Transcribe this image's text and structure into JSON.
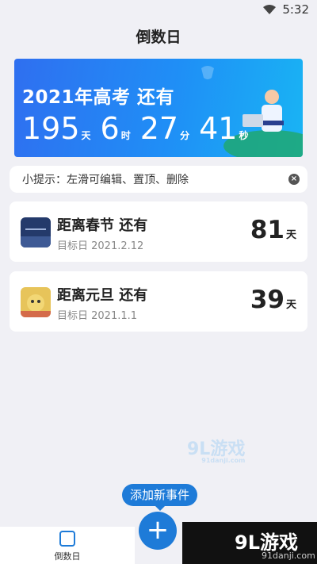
{
  "status": {
    "time": "5:32"
  },
  "header": {
    "title": "倒数日"
  },
  "banner": {
    "title": "2021年高考 还有",
    "days": "195",
    "days_unit": "天",
    "hours": "6",
    "hours_unit": "时",
    "minutes": "27",
    "minutes_unit": "分",
    "seconds": "41",
    "seconds_unit": "秒"
  },
  "tip": {
    "text": "小提示：左滑可编辑、置顶、删除"
  },
  "events": [
    {
      "name": "距离春节 还有",
      "target": "目标日 2021.2.12",
      "days": "81",
      "unit": "天"
    },
    {
      "name": "距离元旦 还有",
      "target": "目标日 2021.1.1",
      "days": "39",
      "unit": "天"
    }
  ],
  "fab": {
    "tooltip": "添加新事件",
    "icon": "plus-icon"
  },
  "tabbar": {
    "label": "倒数日"
  },
  "watermark": {
    "text": "9L游戏",
    "sub": "91danji.com"
  },
  "logo": {
    "text": "9L游戏",
    "sub": "91danji.com"
  },
  "colors": {
    "accent": "#1e7bd8",
    "banner_start": "#2f6ff0",
    "banner_end": "#19b4f4",
    "background": "#f0f0f5"
  }
}
